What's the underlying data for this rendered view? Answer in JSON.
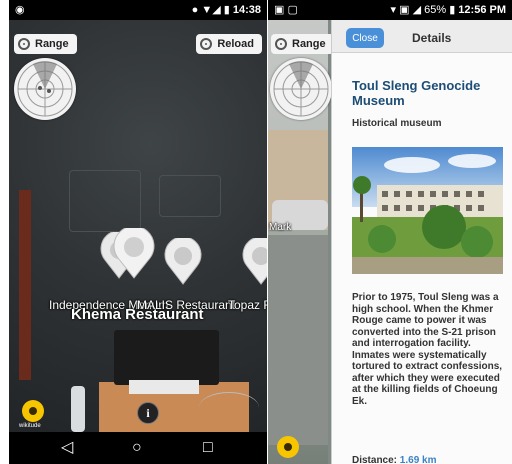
{
  "left_screen": {
    "status_time": "14:38",
    "range_button": "Range",
    "reload_button": "Reload",
    "pois": [
      {
        "label": "Independence Monum"
      },
      {
        "label": "Khema Restaurant"
      },
      {
        "label": "MALIS Restaurant"
      },
      {
        "label": "Topaz R"
      }
    ],
    "wikitude_label": "wikitude",
    "info_button": "i",
    "nav": {
      "back": "◁",
      "home": "○",
      "recent": "□"
    }
  },
  "right_screen": {
    "status_battery": "65%",
    "status_time": "12:56 PM",
    "range_button": "Range",
    "cropped_label": "Mark",
    "details": {
      "close_label": "Close",
      "title": "Details",
      "poi_name": "Toul Sleng Genocide Museum",
      "poi_type": "Historical museum",
      "description": "Prior to 1975, Toul Sleng was a high school. When the Khmer Rouge came to power it was converted into the S-21 prison and interrogation facility. Inmates were systematically tortured to extract confessions, after which they were executed at the killing fields of Choeung Ek.",
      "distance_label": "Distance:",
      "distance_value": "1.69 km"
    }
  },
  "colors": {
    "close_button": "#4a90d9",
    "poi_name": "#1d4d76",
    "distance_value": "#3b82c4",
    "wikitude_badge": "#f7c600"
  }
}
